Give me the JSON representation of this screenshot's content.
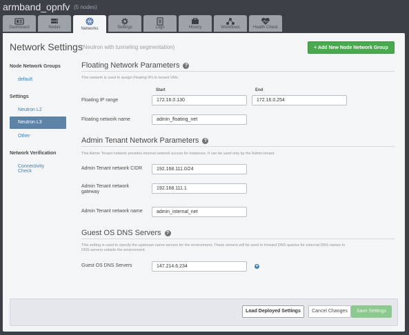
{
  "header": {
    "env_name": "armband_opnfv",
    "node_count": "(5 nodes)"
  },
  "tabs": [
    {
      "label": "Dashboard",
      "icon": "dashboard-icon",
      "active": false
    },
    {
      "label": "Nodes",
      "icon": "nodes-icon",
      "active": false
    },
    {
      "label": "Networks",
      "icon": "networks-icon",
      "active": true
    },
    {
      "label": "Settings",
      "icon": "gear-icon",
      "active": false
    },
    {
      "label": "Logs",
      "icon": "logs-icon",
      "active": false
    },
    {
      "label": "History",
      "icon": "history-icon",
      "active": false
    },
    {
      "label": "Workflows",
      "icon": "workflows-icon",
      "active": false
    },
    {
      "label": "Health Check",
      "icon": "heart-icon",
      "active": false
    }
  ],
  "page": {
    "title": "Network Settings",
    "subtitle": "(Neutron with tunneling segmentation)",
    "add_button": "Add New Node Network Group"
  },
  "sidebar": {
    "groups_header": "Node Network Groups",
    "groups": [
      "default"
    ],
    "settings_header": "Settings",
    "settings": [
      {
        "label": "Neutron L2",
        "selected": false
      },
      {
        "label": "Neutron L3",
        "selected": true
      },
      {
        "label": "Other",
        "selected": false
      }
    ],
    "verification_header": "Network Verification",
    "verification_item_line1": "Connectivity",
    "verification_item_line2": "Check"
  },
  "floating": {
    "title": "Floating Network Parameters",
    "desc": "This network is used to assign Floating IPs to tenant VMs.",
    "start_header": "Start",
    "end_header": "End",
    "ip_range_label": "Floating IP range",
    "ip_start": "172.16.0.130",
    "ip_end": "172.16.0.254",
    "net_name_label": "Floating network name",
    "net_name": "admin_floating_net"
  },
  "admin_tenant": {
    "title": "Admin Tenant Network Parameters",
    "desc": "This Admin Tenant network provides internal network access for instances. It can be used only by the Admin tenant.",
    "cidr_label": "Admin Tenant network CIDR",
    "cidr": "192.168.111.0/24",
    "gateway_label_line1": "Admin Tenant network",
    "gateway_label_line2": "gateway",
    "gateway": "192.168.111.1",
    "name_label": "Admin Tenant network name",
    "name": "admin_internal_net"
  },
  "dns": {
    "title": "Guest OS DNS Servers",
    "desc_line1": "This setting is used to specify the upstream name servers for the environment. These servers will be used to forward DNS queries for external DNS names to",
    "desc_line2": "DNS servers outside the environment.",
    "label": "Guest OS DNS Servers",
    "value": "147.214.6.234"
  },
  "footer": {
    "load_button": "Load Deployed Settings",
    "cancel_button": "Cancel Changes",
    "save_button": "Save Settings"
  },
  "colors": {
    "accent": "#4aa84f",
    "selected": "#5d84a6",
    "link": "#3a7fb4"
  }
}
